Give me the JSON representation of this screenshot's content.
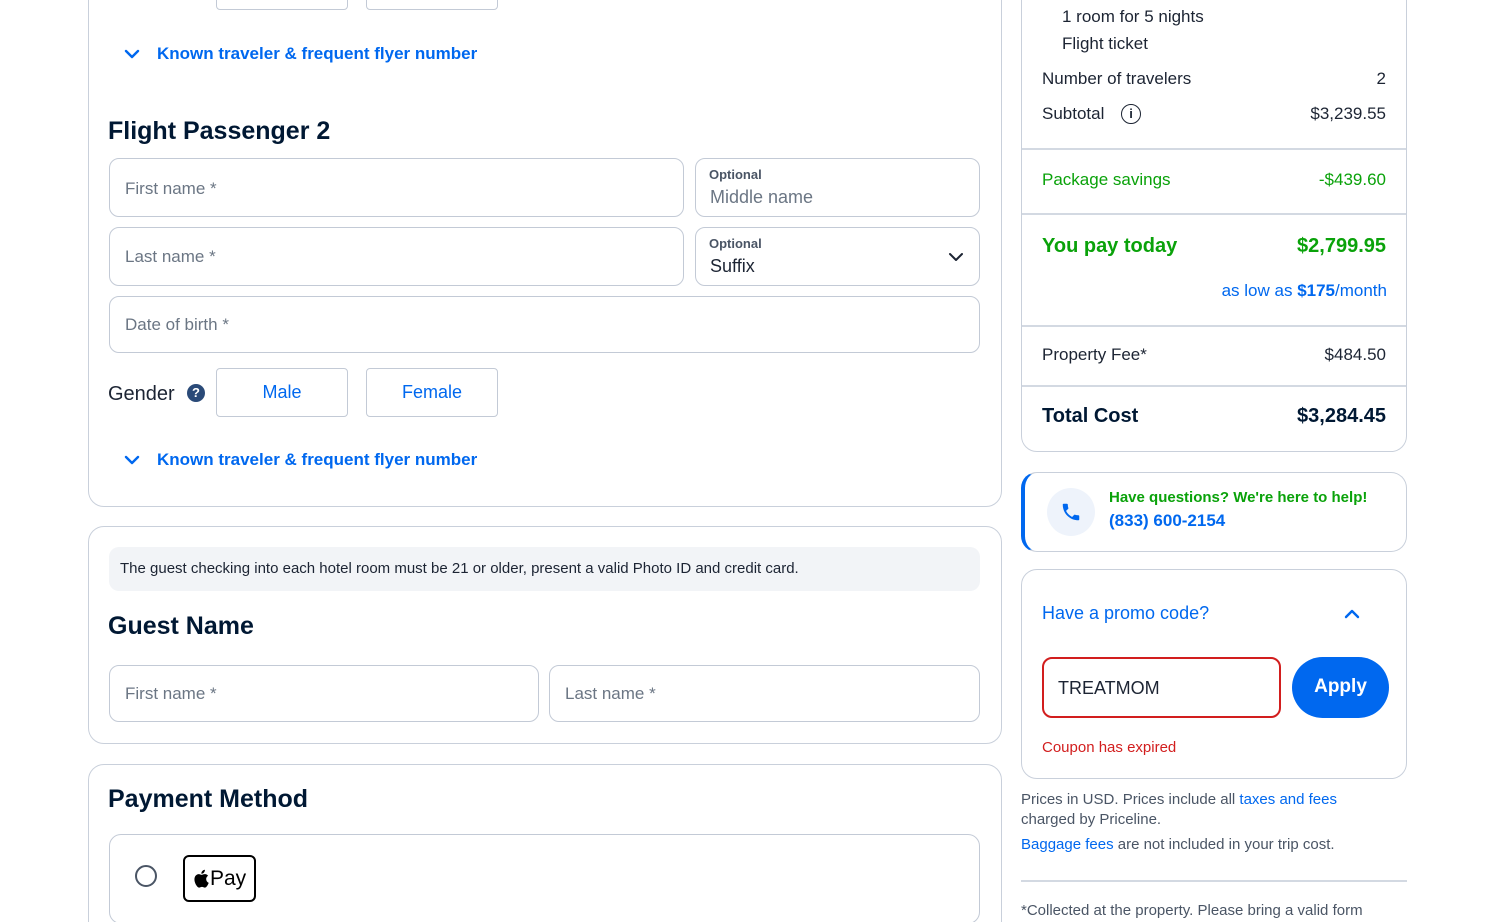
{
  "passenger1": {
    "known_traveler_link": "Known traveler & frequent flyer number"
  },
  "passenger2": {
    "title": "Flight Passenger 2",
    "first_name_placeholder": "First name *",
    "middle_optional": "Optional",
    "middle_placeholder": "Middle name",
    "last_name_placeholder": "Last name *",
    "suffix_optional": "Optional",
    "suffix_value": "Suffix",
    "dob_placeholder": "Date of birth *",
    "gender_label": "Gender",
    "male_label": "Male",
    "female_label": "Female",
    "known_traveler_link": "Known traveler & frequent flyer number"
  },
  "guest": {
    "notice": "The guest checking into each hotel room must be 21 or older, present a valid Photo ID and credit card.",
    "title": "Guest Name",
    "first_name_placeholder": "First name *",
    "last_name_placeholder": "Last name *"
  },
  "payment": {
    "title": "Payment Method",
    "apple_pay_label": "Pay"
  },
  "summary": {
    "room_line": "1 room for 5 nights",
    "flight_line": "Flight ticket",
    "travelers_label": "Number of travelers",
    "travelers_value": "2",
    "subtotal_label": "Subtotal",
    "subtotal_value": "$3,239.55",
    "savings_label": "Package savings",
    "savings_value": "-$439.60",
    "pay_today_label": "You pay today",
    "pay_today_value": "$2,799.95",
    "low_prefix": "as low as ",
    "low_amount": "$175",
    "low_suffix": "/month",
    "property_fee_label": "Property Fee*",
    "property_fee_value": "$484.50",
    "total_label": "Total Cost",
    "total_value": "$3,284.45"
  },
  "help": {
    "question": "Have questions? We're here to help!",
    "phone": "(833) 600-2154"
  },
  "promo": {
    "toggle_label": "Have a promo code?",
    "code_value": "TREATMOM",
    "apply_label": "Apply",
    "error": "Coupon has expired"
  },
  "footnotes": {
    "prices_prefix": "Prices in USD.  Prices include all ",
    "prices_link": "taxes and fees",
    "prices_suffix": "charged by Priceline.",
    "baggage_link": "Baggage fees",
    "baggage_suffix": " are not included in your trip cost.",
    "collected": "*Collected at the property. Please bring a valid form"
  },
  "colors": {
    "brand_blue": "#0068ef",
    "navy": "#001833",
    "green": "#0aa20a",
    "error_red": "#d21e1e"
  }
}
